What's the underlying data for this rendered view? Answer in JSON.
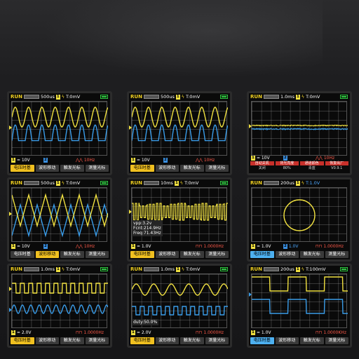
{
  "menu": {
    "m1": "电压时基",
    "m2": "波形移动",
    "m3": "触发光标",
    "m4": "测量光标"
  },
  "s1": {
    "run": "RUN",
    "ch": "1",
    "timebase": "500us",
    "trig": "T:0mV",
    "c1": "10V",
    "c2": "",
    "c3": "10Hz",
    "active": 1
  },
  "s2": {
    "run": "RUN",
    "ch": "1",
    "timebase": "500us",
    "trig": "T:0mV",
    "c1": "10V",
    "c2": "",
    "c3": "10Hz",
    "active": 1
  },
  "s3": {
    "run": "RUN",
    "ch": "1",
    "timebase": "1.0ms",
    "trig": "T:0mV",
    "c1": "10V",
    "c2": "",
    "c3": "10Hz",
    "r1": "自动关机",
    "r2": "背光亮度",
    "r3": "通道颜色",
    "r4": "恢复出厂",
    "s1": "关闭",
    "s2": "80%",
    "s3": "青蓝",
    "s4": "V0.9.1"
  },
  "s4": {
    "run": "RUN",
    "ch": "1",
    "timebase": "500us",
    "trig": "T:0mV",
    "c1": "10V",
    "c2": "",
    "c3": "10Hz",
    "active": 2
  },
  "s5": {
    "run": "RUN",
    "ch": "1",
    "timebase": "10ms",
    "trig": "T:0mV",
    "c1": "1.0V",
    "c2": "",
    "c3": "1.0000Hz",
    "active": 1,
    "vpp": "vpp:3.2v",
    "fcnt": "Fcnt:214.9Hz",
    "freq": "Freq:71.43Hz"
  },
  "s6": {
    "run": "RUN",
    "ch": "1",
    "timebase": "200us",
    "trig": "T:1.0V",
    "c1": "1.0V",
    "c2": "1.0V",
    "c3": "1.0000Hz",
    "active": 1
  },
  "s7": {
    "run": "RUN",
    "ch": "1",
    "timebase": "1.0ms",
    "trig": "T:0mV",
    "c1": "2.0V",
    "c2": "",
    "c3": "1.0000Hz",
    "active": 1
  },
  "s8": {
    "run": "RUN",
    "ch": "1",
    "timebase": "1.0ms",
    "trig": "T:0mV",
    "c1": "2.0V",
    "c2": "",
    "c3": "1.0000Hz",
    "active": 1,
    "duty": "duty:50.0%"
  },
  "s9": {
    "run": "RUN",
    "ch": "1",
    "timebase": "200us",
    "trig": "T:100mV",
    "c1": "1.0V",
    "c2": "",
    "c3": "1.0000KHz",
    "active": 1
  },
  "colors": {
    "ch1": "#f0e040",
    "ch2": "#3a9ce8",
    "accent": "#f0c020",
    "ch2accent": "#4db0f0"
  }
}
